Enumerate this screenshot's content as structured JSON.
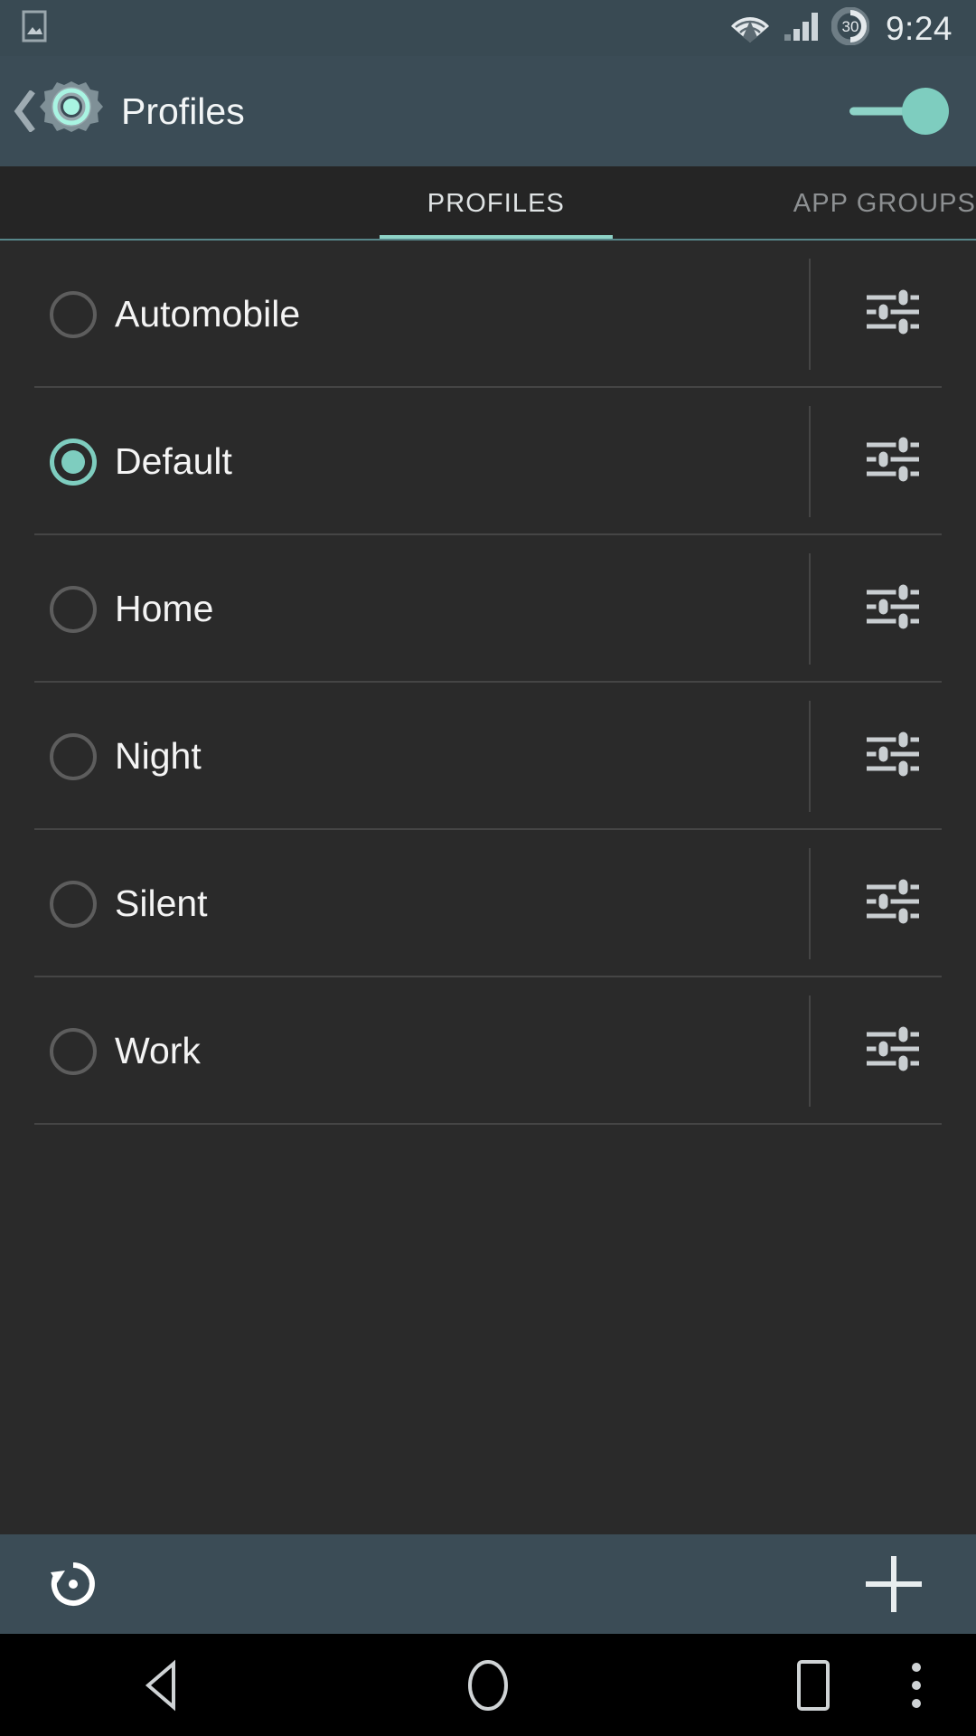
{
  "status_bar": {
    "notification_icon": "image-icon",
    "wifi_icon": "wifi-icon",
    "signal_icon": "cellular-signal-icon",
    "battery": {
      "icon": "battery-icon",
      "level_text": "30"
    },
    "clock": "9:24"
  },
  "header": {
    "back_icon": "back-chevron-icon",
    "app_icon": "gear-icon",
    "title": "Profiles",
    "master_toggle": {
      "name": "profiles-enabled-toggle",
      "state": "on"
    }
  },
  "tabs": [
    {
      "label": "PROFILES",
      "active": true
    },
    {
      "label": "APP GROUPS",
      "active": false
    }
  ],
  "profiles": [
    {
      "label": "Automobile",
      "selected": false,
      "settings_icon": "sliders-icon"
    },
    {
      "label": "Default",
      "selected": true,
      "settings_icon": "sliders-icon"
    },
    {
      "label": "Home",
      "selected": false,
      "settings_icon": "sliders-icon"
    },
    {
      "label": "Night",
      "selected": false,
      "settings_icon": "sliders-icon"
    },
    {
      "label": "Silent",
      "selected": false,
      "settings_icon": "sliders-icon"
    },
    {
      "label": "Work",
      "selected": false,
      "settings_icon": "sliders-icon"
    }
  ],
  "bottom_bar": {
    "reset_icon": "restore-reset-icon",
    "add_icon": "plus-icon"
  },
  "nav_bar": {
    "back_icon": "nav-back-triangle-icon",
    "home_icon": "nav-home-circle-icon",
    "recents_icon": "nav-recents-square-icon",
    "overflow_icon": "nav-overflow-dots-icon"
  },
  "colors": {
    "accent_teal": "#7ecdbf",
    "header_bg": "#3b4c56",
    "status_bg": "#394a53",
    "list_bg": "#2a2a2a",
    "tab_bg": "#252525",
    "divider": "#454545",
    "text_primary": "#f4f4f4",
    "text_muted": "#8d9092"
  }
}
